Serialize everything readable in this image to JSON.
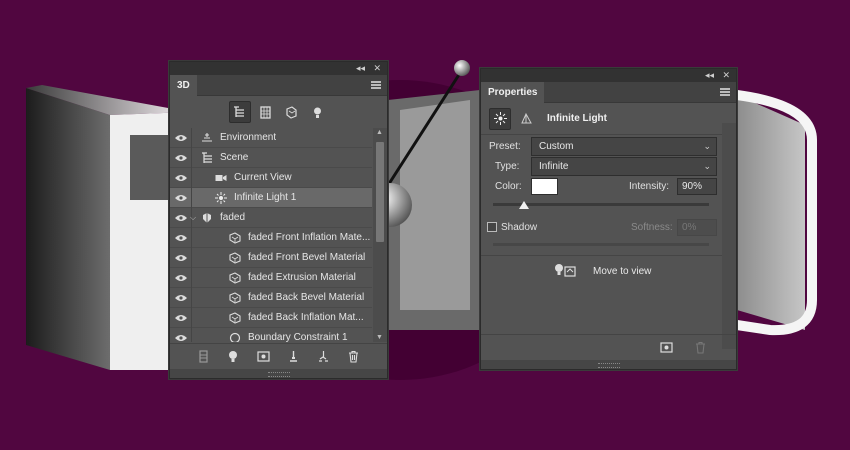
{
  "colors": {
    "background": "#510640",
    "panel": "#535353",
    "selected_row": "#696969",
    "light_color": "#ffffff"
  },
  "panel3d": {
    "tab_label": "3D",
    "collapse_glyph": "◂◂",
    "close_glyph": "✕",
    "filters": [
      {
        "icon": "scene-filter-icon",
        "active": true
      },
      {
        "icon": "mesh-filter-icon",
        "active": false
      },
      {
        "icon": "material-filter-icon",
        "active": false
      },
      {
        "icon": "light-filter-icon",
        "active": false
      }
    ],
    "layers": [
      {
        "label": "Environment",
        "icon": "environment-icon",
        "indent": 0,
        "selected": false
      },
      {
        "label": "Scene",
        "icon": "scene-icon",
        "indent": 0,
        "selected": false
      },
      {
        "label": "Current View",
        "icon": "camera-icon",
        "indent": 1,
        "selected": false
      },
      {
        "label": "Infinite Light 1",
        "icon": "infinite-light-icon",
        "indent": 1,
        "selected": true
      },
      {
        "label": "faded",
        "icon": "mesh-icon",
        "indent": 0,
        "selected": false,
        "expanded": true
      },
      {
        "label": "faded Front Inflation Mate...",
        "icon": "material-icon",
        "indent": 2,
        "selected": false
      },
      {
        "label": "faded Front Bevel Material",
        "icon": "material-icon",
        "indent": 2,
        "selected": false
      },
      {
        "label": "faded Extrusion Material",
        "icon": "material-icon",
        "indent": 2,
        "selected": false
      },
      {
        "label": "faded Back Bevel Material",
        "icon": "material-icon",
        "indent": 2,
        "selected": false
      },
      {
        "label": "faded Back Inflation Mat...",
        "icon": "material-icon",
        "indent": 2,
        "selected": false
      },
      {
        "label": "Boundary Constraint 1",
        "icon": "constraint-icon",
        "indent": 2,
        "selected": false
      }
    ],
    "bottom_tools": [
      "render-icon",
      "new-light-icon",
      "render-settings-icon",
      "move-to-ground-icon",
      "split-icon",
      "trash-icon"
    ]
  },
  "properties": {
    "tab_label": "Properties",
    "title": "Infinite Light",
    "preset_label": "Preset:",
    "preset_value": "Custom",
    "type_label": "Type:",
    "type_value": "Infinite",
    "color_label": "Color:",
    "intensity_label": "Intensity:",
    "intensity_value": "90%",
    "intensity_fraction": 0.9,
    "shadow_label": "Shadow",
    "shadow_checked": false,
    "softness_label": "Softness:",
    "softness_value": "0%",
    "move_to_view_label": "Move to view"
  }
}
